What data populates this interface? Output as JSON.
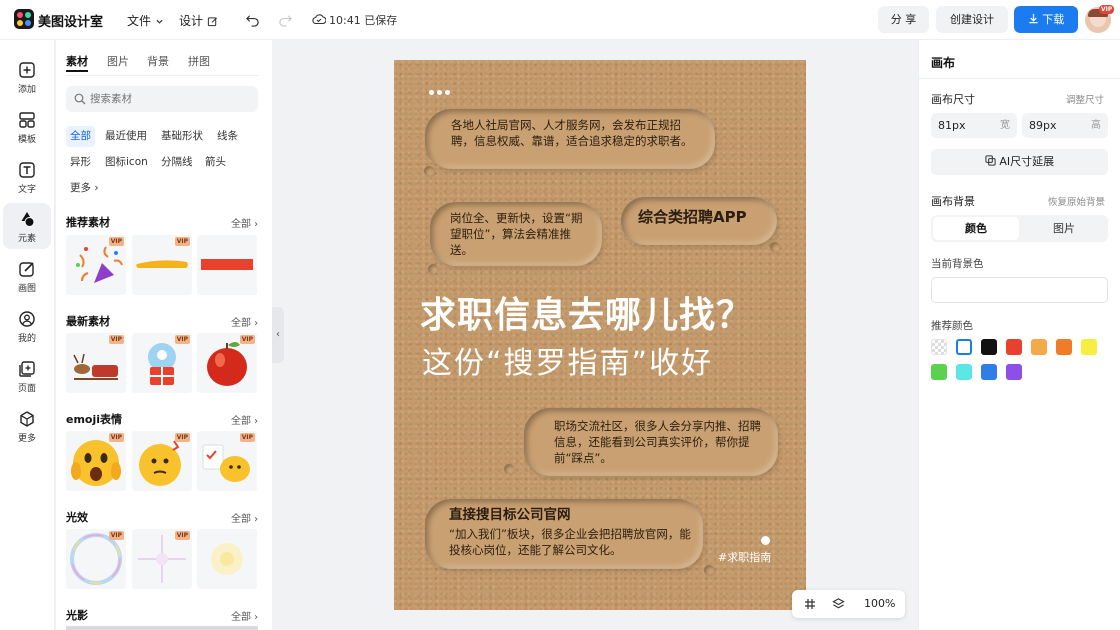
{
  "app": {
    "name": "美图设计室"
  },
  "header": {
    "menu_file": "文件",
    "menu_design": "设计",
    "save_status": "10:41 已保存",
    "share_label": "分 享",
    "create_label": "创建设计",
    "download_label": "下载",
    "avatar_badge": "VIP"
  },
  "sidebar": {
    "items": [
      {
        "label": "添加",
        "icon": "plus-square-icon"
      },
      {
        "label": "模板",
        "icon": "template-icon"
      },
      {
        "label": "文字",
        "icon": "text-icon"
      },
      {
        "label": "元素",
        "icon": "shapes-icon"
      },
      {
        "label": "画图",
        "icon": "draw-icon"
      },
      {
        "label": "我的",
        "icon": "user-icon"
      },
      {
        "label": "页面",
        "icon": "page-add-icon"
      },
      {
        "label": "更多",
        "icon": "cube-icon"
      }
    ]
  },
  "panel": {
    "tabs": [
      "素材",
      "图片",
      "背景",
      "拼图"
    ],
    "search_placeholder": "搜索素材",
    "chips": [
      "全部",
      "最近使用",
      "基础形状",
      "线条",
      "异形",
      "图标icon",
      "分隔线",
      "箭头",
      "更多"
    ],
    "sections": [
      {
        "title": "推荐素材",
        "all": "全部"
      },
      {
        "title": "最新素材",
        "all": "全部"
      },
      {
        "title": "emoji表情",
        "all": "全部"
      },
      {
        "title": "光效",
        "all": "全部"
      },
      {
        "title": "光影",
        "all": "全部"
      }
    ],
    "vip_badge": "VIP"
  },
  "poster": {
    "bubble1": "各地人社局官网、人才服务网，会发布正规招聘，信息权威、靠谱，适合追求稳定的求职者。",
    "bubble2": "岗位全、更新快，设置“期望职位”，算法会精准推送。",
    "bubble3": "综合类招聘APP",
    "headline": "求职信息去哪儿找？",
    "subline": "这份“搜罗指南”收好",
    "bubble4": "职场交流社区，很多人会分享内推、招聘信息，还能看到公司真实评价，帮你提前“踩点”。",
    "bubble5_title": "直接搜目标公司官网",
    "bubble5_body": "“加入我们”板块，很多企业会把招聘放官网，能投核心岗位，还能了解公司文化。",
    "hashtag": "#求职指南"
  },
  "zoom": {
    "level": "100%"
  },
  "right_panel": {
    "title": "画布",
    "size_label": "画布尺寸",
    "resize_hint": "调整尺寸",
    "width_value": "81px",
    "width_unit": "宽",
    "height_value": "89px",
    "height_unit": "高",
    "ai_extend": "AI尺寸延展",
    "bg_label": "画布背景",
    "restore_hint": "恢复原始背景",
    "tab_color": "颜色",
    "tab_image": "图片",
    "current_bg": "当前背景色",
    "recommended": "推荐颜色",
    "swatches": [
      "transparent",
      "#ffffff",
      "#111111",
      "#e8412e",
      "#f4a94a",
      "#f07c28",
      "#f7ef3f",
      "#5bd14e",
      "#5de6e6",
      "#2f7ee8",
      "#8e4ee8"
    ]
  }
}
